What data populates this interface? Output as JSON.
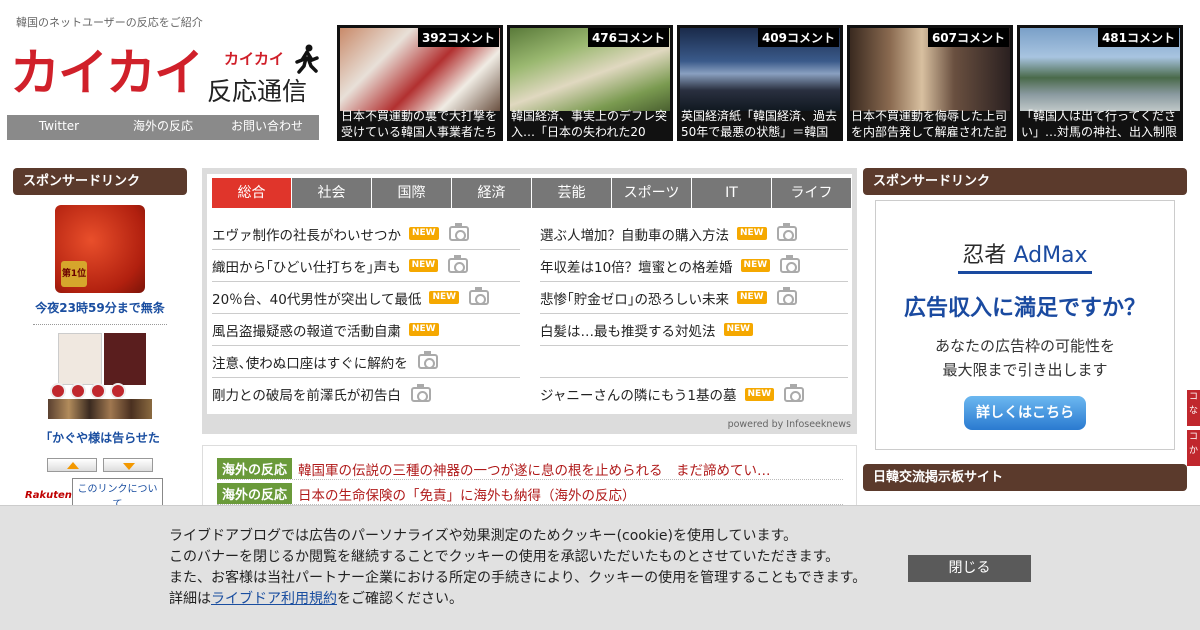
{
  "header": {
    "tagline": "韓国のネットユーザーの反応をご紹介",
    "logo_main": "カイカイ",
    "logo_kana": "カイカイ",
    "logo_sub": "反応通信",
    "nav": [
      "Twitter",
      "海外の反応",
      "お問い合わせ"
    ]
  },
  "top_articles": [
    {
      "comments": "392コメント",
      "caption": "日本不買運動の裏で大打撃を受けている韓国人事業者たち"
    },
    {
      "comments": "476コメント",
      "caption": "韓国経済、事実上のデフレ突入…「日本の失われた20"
    },
    {
      "comments": "409コメント",
      "caption": "英国経済紙「韓国経済、過去50年で最悪の状態」＝韓国"
    },
    {
      "comments": "607コメント",
      "caption": "日本不買運動を侮辱した上司を内部告発して解雇された記"
    },
    {
      "comments": "481コメント",
      "caption": "「韓国人は出て行ってください」…対馬の神社、出入制限"
    }
  ],
  "left_sidebar": {
    "header": "スポンサードリンク",
    "ad1_badge": "第1位",
    "ad1_link": "今夜23時59分まで無条",
    "ad2_link": "「かぐや様は告らせた",
    "rakuten": "Rakuten",
    "about_link": "このリンクについて"
  },
  "news": {
    "tabs": [
      "総合",
      "社会",
      "国際",
      "経済",
      "芸能",
      "スポーツ",
      "IT",
      "ライフ"
    ],
    "left": [
      {
        "title": "エヴァ制作の社長がわいせつか",
        "new": true,
        "photo": true
      },
      {
        "title": "織田から｢ひどい仕打ちを｣声も",
        "new": true,
        "photo": true
      },
      {
        "title": "20％台、40代男性が突出して最低",
        "new": true,
        "photo": true
      },
      {
        "title": "風呂盗撮疑惑の報道で活動自粛",
        "new": true,
        "photo": false
      },
      {
        "title": "注意､使わぬ口座はすぐに解約を",
        "new": false,
        "photo": true
      },
      {
        "title": "剛力との破局を前澤氏が初告白",
        "new": false,
        "photo": true
      }
    ],
    "right": [
      {
        "title": "選ぶ人増加？自動車の購入方法",
        "new": true,
        "photo": true
      },
      {
        "title": "年収差は10倍？壇蜜との格差婚",
        "new": true,
        "photo": true
      },
      {
        "title": "悲惨｢貯金ゼロ｣の恐ろしい未来",
        "new": true,
        "photo": true
      },
      {
        "title": "白髪は…最も推奨する対処法",
        "new": true,
        "photo": false
      },
      {
        "title": "",
        "new": false,
        "photo": false
      },
      {
        "title": "ジャニーさんの隣にもう1基の墓",
        "new": true,
        "photo": true
      }
    ],
    "new_label": "NEW",
    "powered": "powered by Infoseeknews"
  },
  "overseas": {
    "tag": "海外の反応",
    "items": [
      "韓国軍の伝説の三種の神器の一つが遂に息の根を止められる　まだ諦めてい…",
      "日本の生命保険の「免責」に海外も納得（海外の反応）"
    ]
  },
  "right_sidebar": {
    "header": "スポンサードリンク",
    "ad_brand_a": "忍者",
    "ad_brand_b": "AdMax",
    "ad_headline": "広告収入に満足ですか？",
    "ad_sub1": "あなたの広告枠の可能性を",
    "ad_sub2": "最大限まで引き出します",
    "ad_button": "詳しくはこちら",
    "header2": "日韓交流掲示板サイト",
    "edge1": "コ\nな",
    "edge2": "コ\nか"
  },
  "cookie": {
    "line1": "ライブドアブログでは広告のパーソナライズや効果測定のためクッキー(cookie)を使用しています。",
    "line2": "このバナーを閉じるか閲覧を継続することでクッキーの使用を承認いただいたものとさせていただきます。",
    "line3": "また、お客様は当社パートナー企業における所定の手続きにより、クッキーの使用を管理することもできます。",
    "line4_pre": "詳細は",
    "line4_link": "ライブドア利用規約",
    "line4_post": "をご確認ください。",
    "close": "閉じる"
  },
  "colors": {
    "accent": "#e0352b",
    "sidebar_header": "#5b3a2c",
    "overseas_tag": "#6a9a3a"
  }
}
